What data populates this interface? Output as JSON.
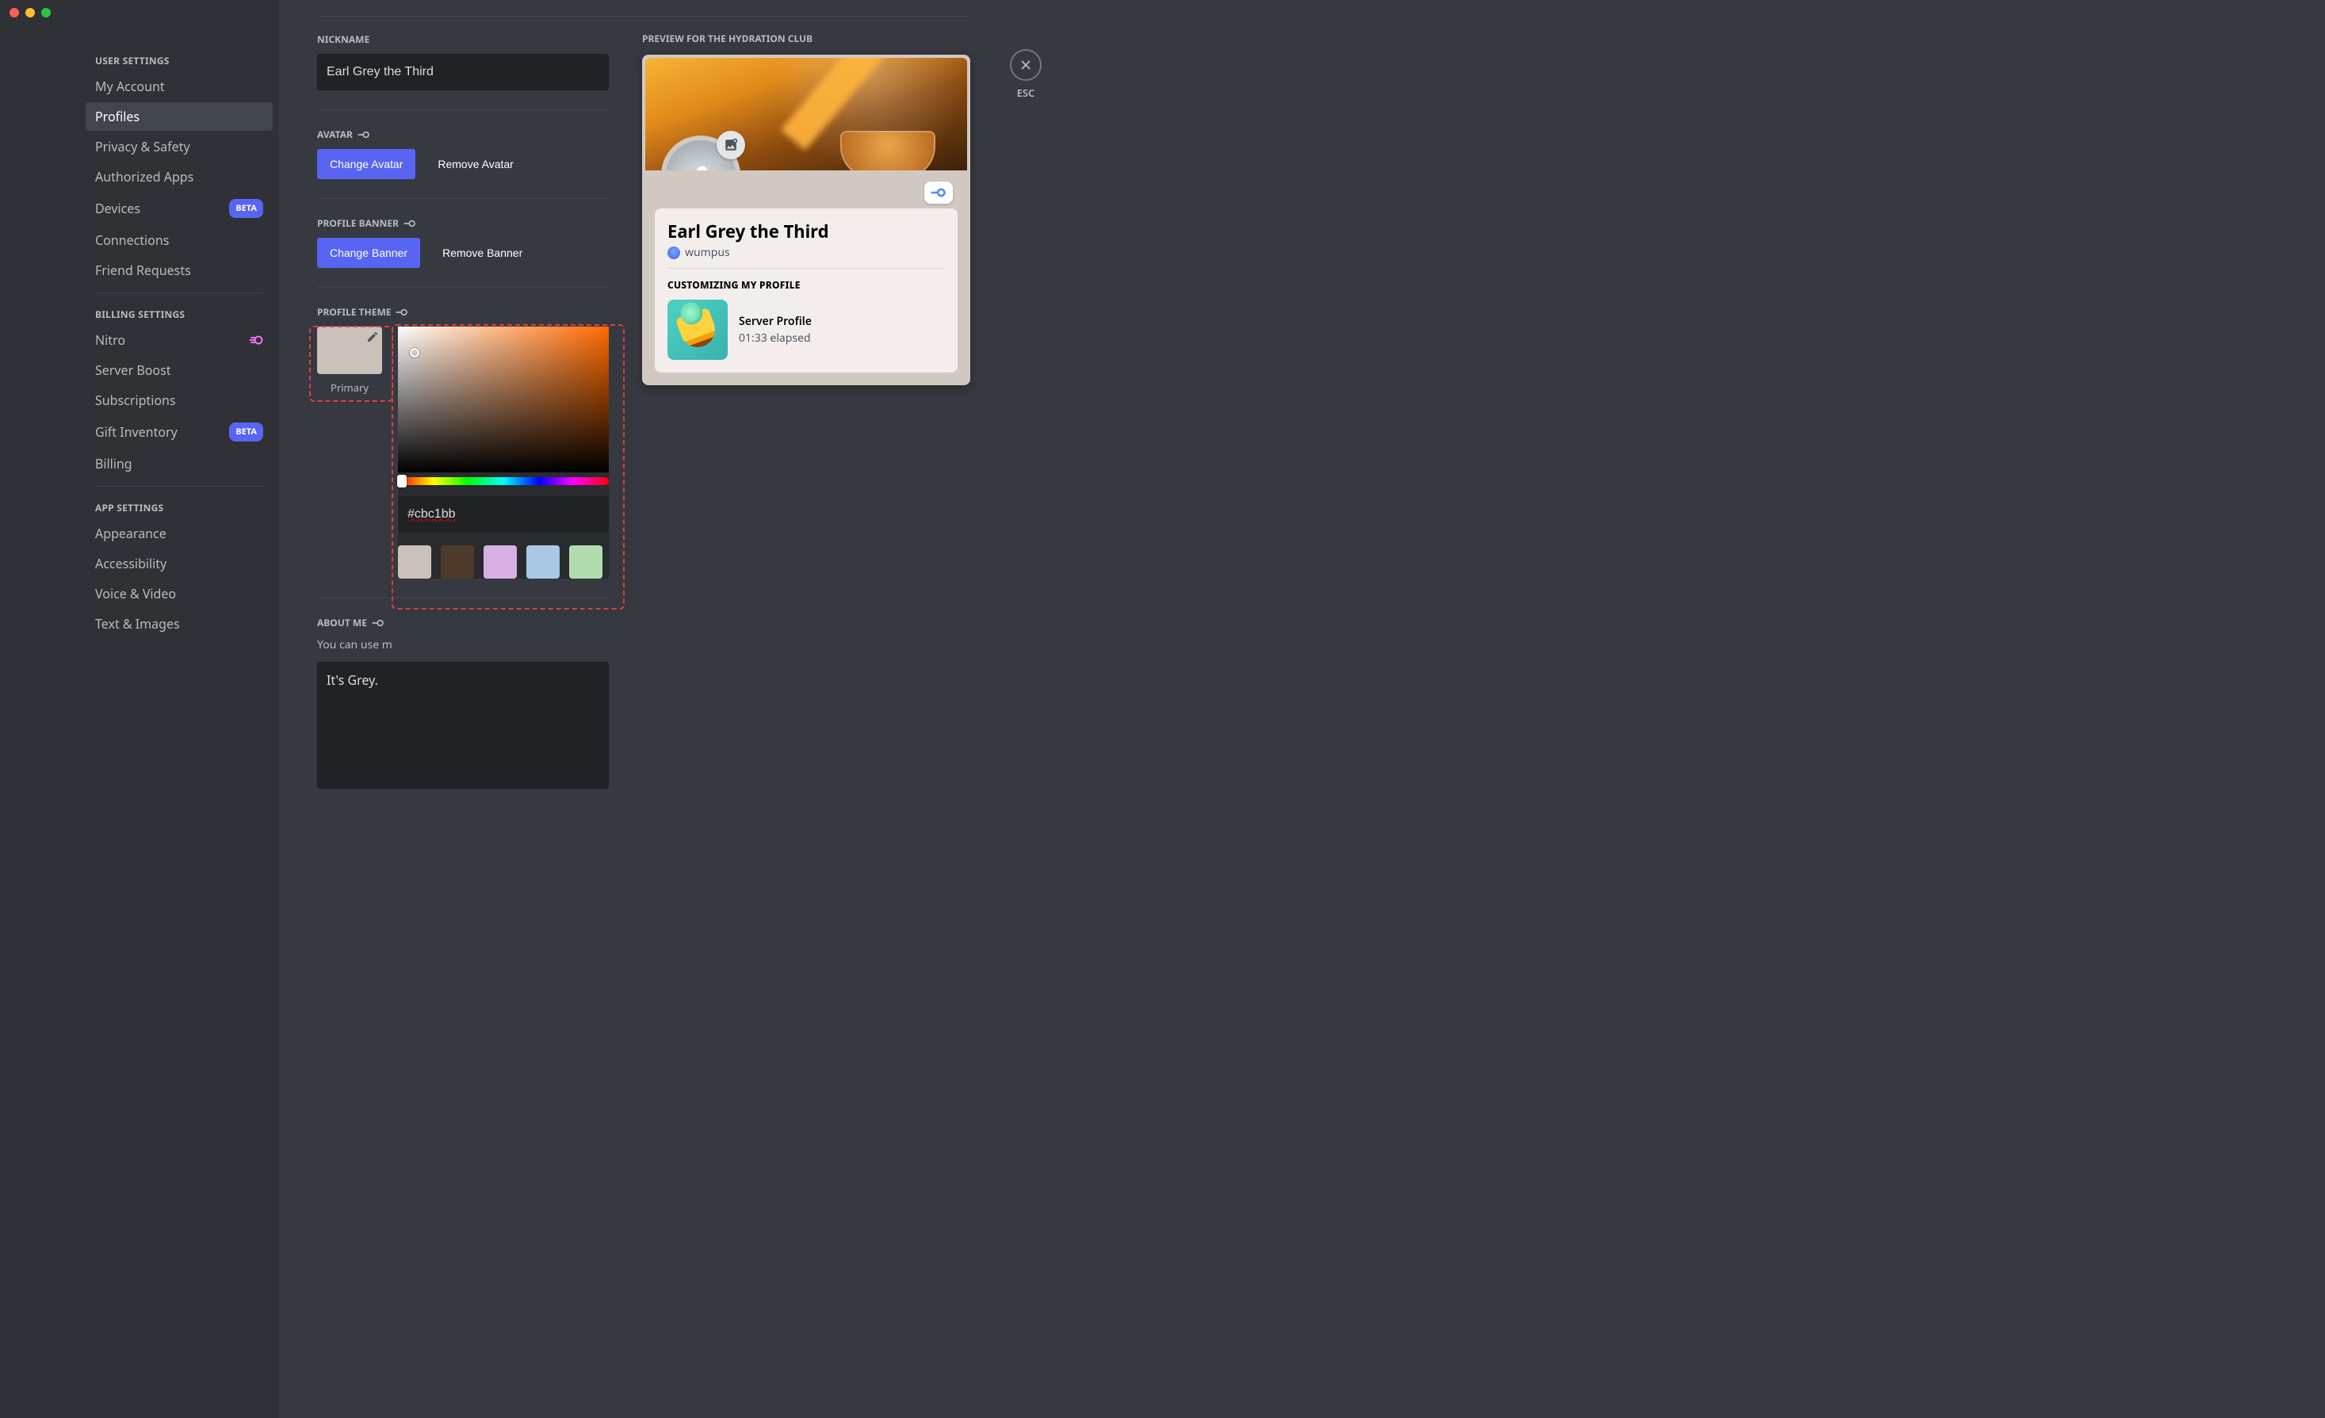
{
  "window": {
    "traffic_light_colors": [
      "#ff5f57",
      "#febc2e",
      "#28c840"
    ]
  },
  "sidebar": {
    "sections": [
      {
        "header": "USER SETTINGS",
        "items": [
          {
            "label": "My Account",
            "active": false
          },
          {
            "label": "Profiles",
            "active": true
          },
          {
            "label": "Privacy & Safety",
            "active": false
          },
          {
            "label": "Authorized Apps",
            "active": false
          },
          {
            "label": "Devices",
            "active": false,
            "badge": "BETA"
          },
          {
            "label": "Connections",
            "active": false
          },
          {
            "label": "Friend Requests",
            "active": false
          }
        ]
      },
      {
        "header": "BILLING SETTINGS",
        "items": [
          {
            "label": "Nitro",
            "active": false,
            "nitro_icon": true
          },
          {
            "label": "Server Boost",
            "active": false
          },
          {
            "label": "Subscriptions",
            "active": false
          },
          {
            "label": "Gift Inventory",
            "active": false,
            "badge": "BETA"
          },
          {
            "label": "Billing",
            "active": false
          }
        ]
      },
      {
        "header": "APP SETTINGS",
        "items": [
          {
            "label": "Appearance",
            "active": false
          },
          {
            "label": "Accessibility",
            "active": false
          },
          {
            "label": "Voice & Video",
            "active": false
          },
          {
            "label": "Text & Images",
            "active": false
          }
        ]
      }
    ]
  },
  "form": {
    "nickname_label": "NICKNAME",
    "nickname_value": "Earl Grey the Third",
    "avatar_label": "AVATAR",
    "change_avatar": "Change Avatar",
    "remove_avatar": "Remove Avatar",
    "banner_label": "PROFILE BANNER",
    "change_banner": "Change Banner",
    "remove_banner": "Remove Banner",
    "theme_label": "PROFILE THEME",
    "theme_primary_label": "Primary",
    "aboutme_label": "ABOUT ME",
    "aboutme_hint": "You can use m",
    "aboutme_value": "It's Grey."
  },
  "color_picker": {
    "hex_value": "#cbc1bb",
    "swatches": [
      "#cbc1bb",
      "#4f3b2b",
      "#d8b0e3",
      "#a9c8e6",
      "#b0dcb0"
    ]
  },
  "preview": {
    "header": "PREVIEW FOR THE HYDRATION CLUB",
    "display_name": "Earl Grey the Third",
    "username": "wumpus",
    "customizing_label": "CUSTOMIZING MY PROFILE",
    "activity_line1": "Server Profile",
    "activity_line2": "01:33 elapsed"
  },
  "close": {
    "esc_label": "ESC"
  }
}
